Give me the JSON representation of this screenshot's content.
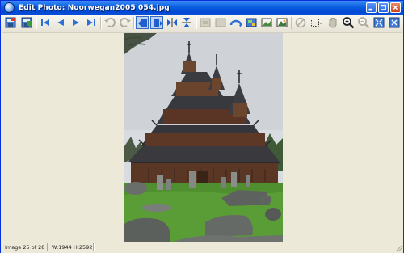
{
  "window": {
    "title": "Edit Photo: Noorwegan2005 054.jpg"
  },
  "title_buttons": [
    {
      "name": "minimize-button",
      "icon": "minimize-icon"
    },
    {
      "name": "maximize-button",
      "icon": "maximize-icon"
    },
    {
      "name": "close-button",
      "icon": "close-icon"
    }
  ],
  "toolbar": {
    "items": [
      {
        "name": "save-icon-button",
        "icon": "save-icon"
      },
      {
        "name": "save-as-button",
        "icon": "save-as-icon"
      },
      {
        "name": "first-image-button",
        "icon": "first-image-icon"
      },
      {
        "name": "previous-image-button",
        "icon": "previous-image-icon"
      },
      {
        "name": "next-image-button",
        "icon": "next-image-icon"
      },
      {
        "name": "last-image-button",
        "icon": "last-image-icon"
      },
      {
        "name": "undo-button",
        "icon": "undo-icon"
      },
      {
        "name": "redo-button",
        "icon": "redo-icon"
      },
      {
        "name": "rotate-left-button",
        "icon": "rotate-left-icon"
      },
      {
        "name": "rotate-right-button",
        "icon": "rotate-right-icon"
      },
      {
        "name": "flip-horizontal-button",
        "icon": "flip-horizontal-icon"
      },
      {
        "name": "flip-vertical-button",
        "icon": "flip-vertical-icon"
      },
      {
        "name": "resize-button",
        "icon": "resize-icon"
      },
      {
        "name": "crop-button",
        "icon": "crop-icon"
      },
      {
        "name": "red-eye-button",
        "icon": "red-eye-icon"
      },
      {
        "name": "adjust-colors-button",
        "icon": "adjust-colors-icon"
      },
      {
        "name": "enhance-button",
        "icon": "enhance-icon"
      },
      {
        "name": "effects-button",
        "icon": "effects-icon"
      },
      {
        "name": "clear-selection-button",
        "icon": "clear-selection-icon"
      },
      {
        "name": "selection-tool-button",
        "icon": "selection-icon"
      },
      {
        "name": "hand-tool-button",
        "icon": "hand-icon"
      },
      {
        "name": "zoom-in-button",
        "icon": "zoom-in-icon"
      },
      {
        "name": "zoom-out-button",
        "icon": "zoom-out-icon"
      },
      {
        "name": "fit-to-window-button",
        "icon": "fit-to-window-icon"
      },
      {
        "name": "actual-size-button",
        "icon": "actual-size-icon"
      }
    ]
  },
  "photo": {
    "subject": "stave-church-photo"
  },
  "status": {
    "image_position": "Image 25 of 28",
    "dimensions": "W:1944 H:2592"
  },
  "colors": {
    "titlebar": "#0a5fe0",
    "toolbar_active": "#316ac5",
    "workspace": "#ece9d8"
  }
}
